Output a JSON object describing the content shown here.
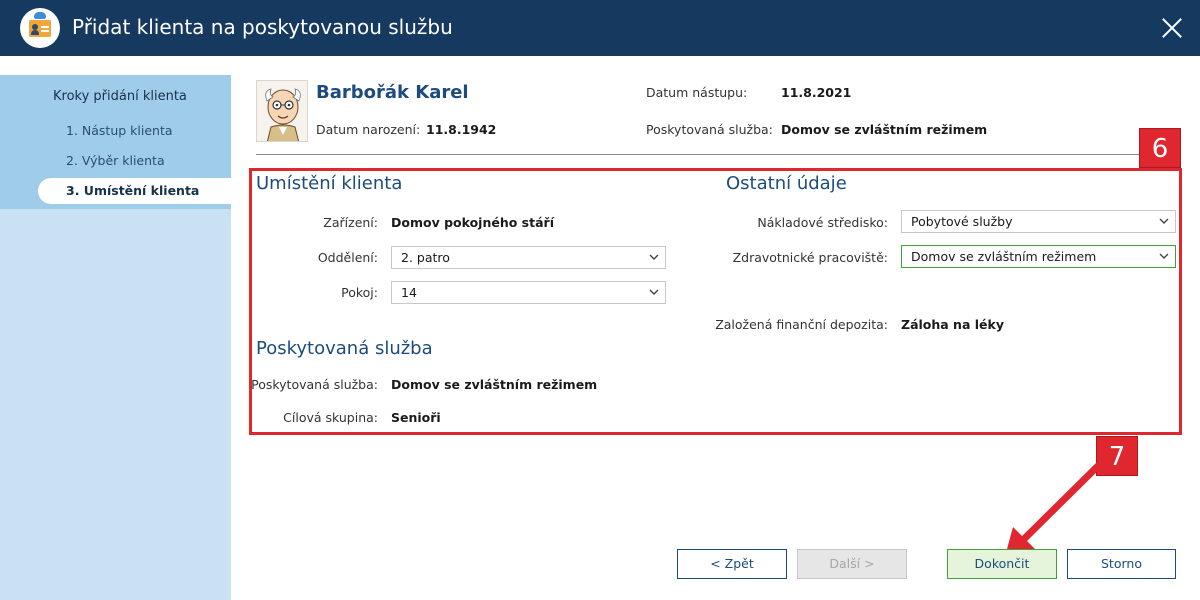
{
  "window": {
    "title": "Přidat klienta na poskytovanou službu"
  },
  "sidebar": {
    "title": "Kroky přidání klienta",
    "steps": [
      {
        "label": "1. Nástup klienta"
      },
      {
        "label": "2. Výběr klienta"
      },
      {
        "label": "3. Umístění klienta"
      }
    ]
  },
  "client": {
    "name": "Barbořák Karel",
    "birth_label": "Datum narození:",
    "birth_value": "11.8.1942",
    "entry_label": "Datum nástupu:",
    "entry_value": "11.8.2021",
    "service_label": "Poskytovaná služba:",
    "service_value": "Domov se zvláštním režimem"
  },
  "placement": {
    "title": "Umístění klienta",
    "facility_label": "Zařízení:",
    "facility_value": "Domov pokojného stáří",
    "department_label": "Oddělení:",
    "department_value": "2. patro",
    "room_label": "Pokoj:",
    "room_value": "14"
  },
  "service": {
    "title": "Poskytovaná služba",
    "service_label": "Poskytovaná služba:",
    "service_value": "Domov se zvláštním režimem",
    "group_label": "Cílová skupina:",
    "group_value": "Senioři"
  },
  "other": {
    "title": "Ostatní údaje",
    "cost_center_label": "Nákladové středisko:",
    "cost_center_value": "Pobytové služby",
    "health_label": "Zdravotnické pracoviště:",
    "health_value": "Domov se zvláštním režimem",
    "deposit_label": "Založená finanční depozita:",
    "deposit_value": "Záloha na léky"
  },
  "annotations": {
    "box_number": "6",
    "arrow_number": "7"
  },
  "buttons": {
    "back": "< Zpět",
    "next": "Další >",
    "finish": "Dokončit",
    "cancel": "Storno"
  },
  "colors": {
    "titlebar": "#163a5f",
    "accent": "#1d4c7c",
    "highlight": "#e0262e",
    "success_border": "#3fa13a"
  }
}
